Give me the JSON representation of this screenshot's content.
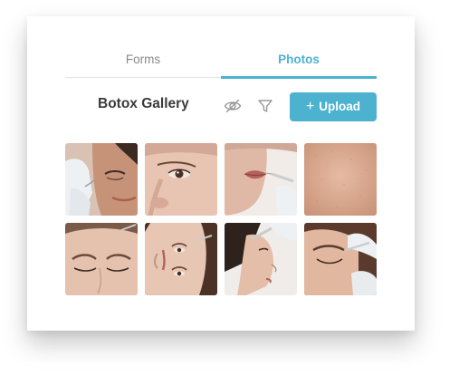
{
  "tabs": [
    {
      "label": "Forms",
      "active": false
    },
    {
      "label": "Photos",
      "active": true
    }
  ],
  "header": {
    "title": "Botox Gallery",
    "hide_icon": "eye-off-icon",
    "filter_icon": "filter-icon",
    "upload_label": "Upload",
    "upload_icon": "plus-icon"
  },
  "colors": {
    "accent": "#4db2d0",
    "title": "#3a3a3a",
    "inactive_tab": "#8a8a8a"
  },
  "gallery": {
    "photos": [
      {
        "subject": "eyes closed with gloved hands"
      },
      {
        "subject": "eye and nose close-up"
      },
      {
        "subject": "lip injection"
      },
      {
        "subject": "skin texture"
      },
      {
        "subject": "forehead with closed eyes"
      },
      {
        "subject": "face tilted sideways"
      },
      {
        "subject": "side profile with injection"
      },
      {
        "subject": "temple injection"
      }
    ]
  }
}
